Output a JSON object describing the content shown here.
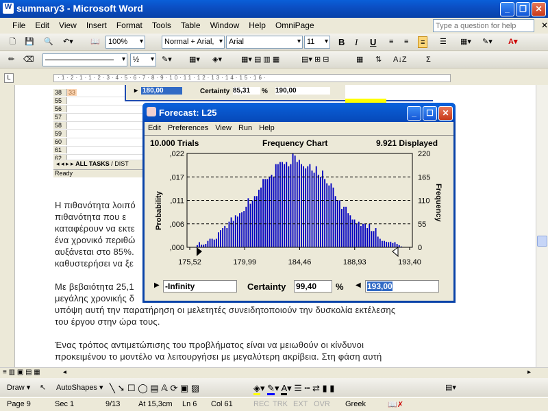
{
  "window": {
    "title": "summary3 - Microsoft Word",
    "icon": "word-icon"
  },
  "menu": [
    "File",
    "Edit",
    "View",
    "Insert",
    "Format",
    "Tools",
    "Table",
    "Window",
    "Help",
    "OmniPage"
  ],
  "help_box": {
    "placeholder": "Type a question for help"
  },
  "toolbar": {
    "zoom": "100%",
    "read_label": "Read",
    "style": "Normal + Arial,",
    "font": "Arial",
    "size": "11",
    "bold": "B",
    "italic": "I",
    "underline": "U",
    "line_weight": "½"
  },
  "document": {
    "lines": [
      "Η πιθανότητα λοιπό",
      "πιθανότητα που ε",
      "καταφέρουν να εκτε",
      "ένα χρονικό περιθώ",
      "αυξάνεται στο 85%.",
      "καθυστερήσει να ξε",
      "Με βεβαιότητα 25,1",
      "μεγάλης χρονικής δ",
      "υπόψη αυτή την παρατήρηση οι μελετητές συνειδητοποιούν την δυσκολία εκτέλεσης",
      "του έργου στην ώρα τους.",
      "Ένας τρόπος αντιμετώπισης του προβλήματος είναι να μειωθούν οι κίνδυνοι",
      "προκειμένου το μοντέλο να λειτουργήσει με μεγαλύτερη ακρίβεια. Στη φάση αυτή"
    ]
  },
  "spreadsheet": {
    "rows": [
      "38",
      "55",
      "56",
      "57",
      "58",
      "59",
      "60",
      "61",
      "62"
    ],
    "cell_38": "33",
    "tabs": [
      "ALL TASKS",
      "DIST"
    ],
    "status": "Ready",
    "back_dialog": {
      "low": "180,00",
      "certainty_label": "Certainty",
      "certainty": "85,31",
      "pct": "%",
      "high": "190,00"
    }
  },
  "forecast": {
    "title": "Forecast: L25",
    "menu": [
      "Edit",
      "Preferences",
      "View",
      "Run",
      "Help"
    ],
    "trials": "10.000 Trials",
    "chart_title": "Frequency Chart",
    "displayed": "9.921 Displayed",
    "low": "-Infinity",
    "certainty_label": "Certainty",
    "certainty": "99,40",
    "pct": "%",
    "high": "193,00"
  },
  "chart_data": {
    "type": "bar",
    "title": "Frequency Chart",
    "ylabel": "Probability",
    "y2label": "Frequency",
    "x_ticks": [
      "175,52",
      "179,99",
      "184,46",
      "188,93",
      "193,40"
    ],
    "xlim": [
      175.52,
      193.4
    ],
    "y_ticks": [
      ",000",
      ",006",
      ",011",
      ",017",
      ",022"
    ],
    "ylim": [
      0,
      0.022
    ],
    "y2_ticks": [
      "0",
      "55",
      "110",
      "165",
      "220"
    ],
    "y2lim": [
      0,
      220
    ],
    "grid": "horizontal dashed",
    "bar_color": "#0000c0",
    "frequencies": [
      5,
      12,
      6,
      6,
      8,
      15,
      20,
      20,
      18,
      20,
      35,
      40,
      45,
      50,
      45,
      60,
      70,
      62,
      75,
      72,
      80,
      82,
      85,
      95,
      115,
      102,
      110,
      120,
      120,
      135,
      140,
      160,
      160,
      160,
      165,
      170,
      165,
      195,
      195,
      200,
      200,
      195,
      200,
      190,
      195,
      220,
      215,
      200,
      205,
      195,
      190,
      185,
      190,
      195,
      180,
      175,
      190,
      170,
      165,
      180,
      160,
      150,
      145,
      150,
      140,
      120,
      110,
      110,
      90,
      95,
      95,
      80,
      75,
      65,
      65,
      55,
      60,
      50,
      55,
      55,
      45,
      55,
      38,
      38,
      45,
      25,
      20,
      15,
      15,
      13,
      12,
      13,
      10,
      12,
      8,
      5,
      2
    ]
  },
  "drawbar": {
    "draw": "Draw",
    "autoshapes": "AutoShapes"
  },
  "status": {
    "page": "Page 9",
    "sec": "Sec 1",
    "pages": "9/13",
    "at": "At 15,3cm",
    "ln": "Ln 6",
    "col": "Col 61",
    "rec": "REC",
    "trk": "TRK",
    "ext": "EXT",
    "ovr": "OVR",
    "lang": "Greek"
  }
}
